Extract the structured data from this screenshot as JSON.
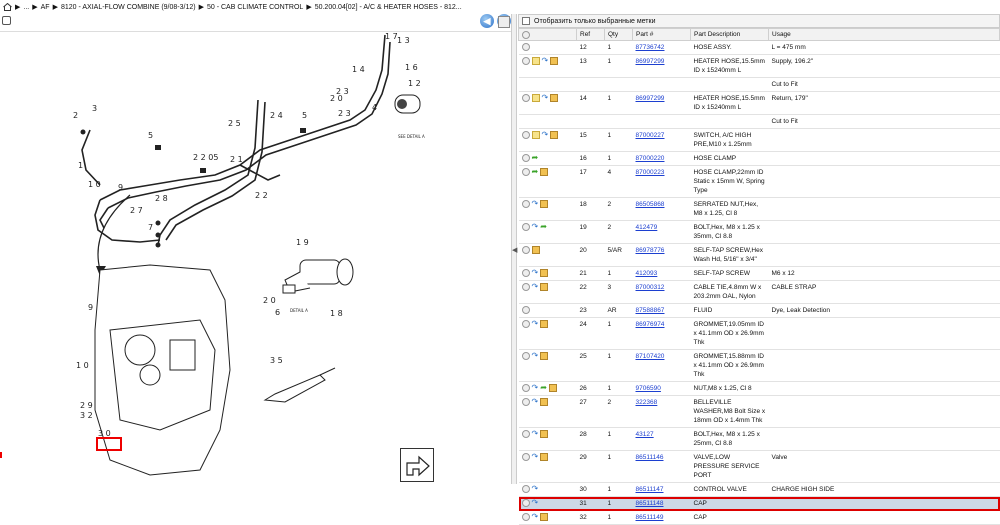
{
  "breadcrumb": {
    "items": [
      "...",
      "AF",
      "8120 - AXIAL-FLOW COMBINE (9/08-3/12)",
      "50 - CAB CLIMATE CONTROL",
      "50.200.04[02] - A/C & HEATER HOSES - 812..."
    ]
  },
  "nav": {
    "back": "◀",
    "forward": "▶"
  },
  "filter": {
    "label": "Отобразить только выбранные метки"
  },
  "table": {
    "headers": [
      "",
      "Ref",
      "Qty",
      "Part #",
      "Part Description",
      "Usage"
    ],
    "rows": [
      {
        "icons": [
          "circ"
        ],
        "ref": "12",
        "qty": "1",
        "part": "87736742",
        "desc": "HOSE ASSY.",
        "usage": "L = 475 mm"
      },
      {
        "icons": [
          "circ",
          "note",
          "arrow",
          "box"
        ],
        "ref": "13",
        "qty": "1",
        "part": "86997299",
        "desc": "HEATER HOSE,15.5mm ID x 15240mm L",
        "usage": "Supply, 196.2\""
      },
      {
        "icons": [],
        "ref": "",
        "qty": "",
        "part": "",
        "desc": "",
        "usage": "Cut to Fit"
      },
      {
        "icons": [
          "circ",
          "note",
          "arrow",
          "box"
        ],
        "ref": "14",
        "qty": "1",
        "part": "86997299",
        "desc": "HEATER HOSE,15.5mm ID x 15240mm L",
        "usage": "Return, 179\""
      },
      {
        "icons": [],
        "ref": "",
        "qty": "",
        "part": "",
        "desc": "",
        "usage": "Cut to Fit"
      },
      {
        "icons": [
          "circ",
          "note",
          "arrow",
          "box"
        ],
        "ref": "15",
        "qty": "1",
        "part": "87000227",
        "desc": "SWITCH, A/C HIGH PRE,M10 x 1.25mm",
        "usage": ""
      },
      {
        "icons": [
          "circ",
          "green"
        ],
        "ref": "16",
        "qty": "1",
        "part": "87000220",
        "desc": "HOSE CLAMP",
        "usage": ""
      },
      {
        "icons": [
          "circ",
          "green",
          "box"
        ],
        "ref": "17",
        "qty": "4",
        "part": "87000223",
        "desc": "HOSE CLAMP,22mm ID Static x 15mm W, Spring Type",
        "usage": ""
      },
      {
        "icons": [
          "circ",
          "arrow",
          "box"
        ],
        "ref": "18",
        "qty": "2",
        "part": "86505868",
        "desc": "SERRATED NUT,Hex, M8 x 1.25, Cl 8",
        "usage": ""
      },
      {
        "icons": [
          "circ",
          "arrow",
          "green"
        ],
        "ref": "19",
        "qty": "2",
        "part": "412479",
        "desc": "BOLT,Hex, M8 x 1.25 x 35mm, Cl 8.8",
        "usage": ""
      },
      {
        "icons": [
          "circ",
          "box"
        ],
        "ref": "20",
        "qty": "5/AR",
        "part": "86978776",
        "desc": "SELF-TAP SCREW,Hex Wash Hd, 5/16\" x 3/4\"",
        "usage": ""
      },
      {
        "icons": [
          "circ",
          "arrow",
          "box"
        ],
        "ref": "21",
        "qty": "1",
        "part": "412093",
        "desc": "SELF-TAP SCREW",
        "usage": "M6 x 12"
      },
      {
        "icons": [
          "circ",
          "arrow",
          "box"
        ],
        "ref": "22",
        "qty": "3",
        "part": "87000312",
        "desc": "CABLE TIE,4.8mm W x 203.2mm OAL, Nylon",
        "usage": "CABLE STRAP"
      },
      {
        "icons": [
          "circ"
        ],
        "ref": "23",
        "qty": "AR",
        "part": "87588867",
        "desc": "FLUID",
        "usage": "Dye, Leak Detection"
      },
      {
        "icons": [
          "circ",
          "arrow",
          "box"
        ],
        "ref": "24",
        "qty": "1",
        "part": "86976974",
        "desc": "GROMMET,19.05mm ID x 41.1mm OD x 26.9mm Thk",
        "usage": ""
      },
      {
        "icons": [
          "circ",
          "arrow",
          "box"
        ],
        "ref": "25",
        "qty": "1",
        "part": "87107420",
        "desc": "GROMMET,15.88mm ID x 41.1mm OD x 26.9mm Thk",
        "usage": ""
      },
      {
        "icons": [
          "circ",
          "arrow",
          "green",
          "box"
        ],
        "ref": "26",
        "qty": "1",
        "part": "9706590",
        "desc": "NUT,M8 x 1.25, Cl 8",
        "usage": ""
      },
      {
        "icons": [
          "circ",
          "arrow",
          "box"
        ],
        "ref": "27",
        "qty": "2",
        "part": "322368",
        "desc": "BELLEVILLE WASHER,M8 Bolt Size x 18mm OD x 1.4mm Thk",
        "usage": ""
      },
      {
        "icons": [
          "circ",
          "arrow",
          "box"
        ],
        "ref": "28",
        "qty": "1",
        "part": "43127",
        "desc": "BOLT,Hex, M8 x 1.25 x 25mm, Cl 8.8",
        "usage": ""
      },
      {
        "icons": [
          "circ",
          "arrow",
          "box"
        ],
        "ref": "29",
        "qty": "1",
        "part": "86511146",
        "desc": "VALVE,LOW PRESSURE SERVICE PORT",
        "usage": "Valve"
      },
      {
        "icons": [
          "circ",
          "arrow"
        ],
        "ref": "30",
        "qty": "1",
        "part": "86511147",
        "desc": "CONTROL VALVE",
        "usage": "CHARGE HIGH SIDE"
      },
      {
        "icons": [
          "circ",
          "arrow"
        ],
        "ref": "31",
        "qty": "1",
        "part": "86511148",
        "desc": "CAP",
        "usage": "",
        "selected": true
      },
      {
        "icons": [
          "circ",
          "arrow",
          "box"
        ],
        "ref": "32",
        "qty": "1",
        "part": "86511149",
        "desc": "CAP",
        "usage": ""
      }
    ]
  },
  "drawing": {
    "labels": [
      "17",
      "13",
      "14",
      "16",
      "12",
      "23",
      "20",
      "24",
      "25",
      "5",
      "23",
      "4",
      "3",
      "2",
      "5",
      "2205",
      "21",
      "22",
      "1",
      "19",
      "9",
      "10",
      "27",
      "28",
      "7",
      "19",
      "20",
      "6",
      "18",
      "9",
      "10",
      "29",
      "32",
      "30",
      "35"
    ],
    "detail_text": [
      "SEE DETAIL A",
      "DETAIL A"
    ],
    "callout_text": "31"
  }
}
